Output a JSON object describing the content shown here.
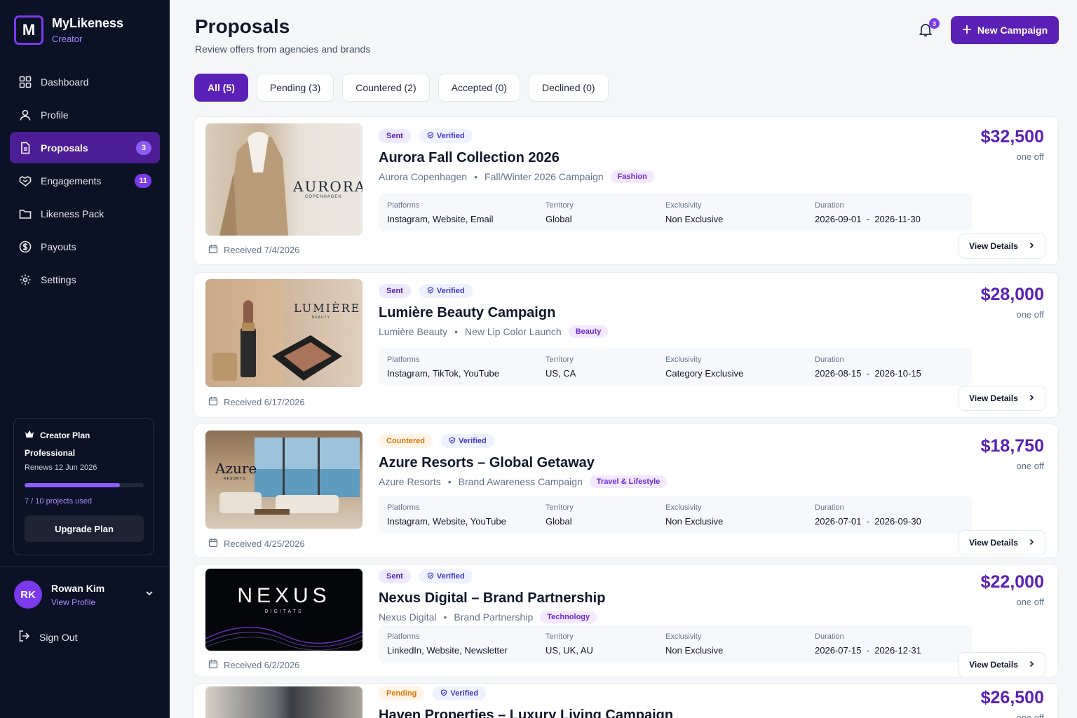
{
  "brand": {
    "initial": "M",
    "name": "MyLikeness",
    "role": "Creator"
  },
  "nav": [
    {
      "label": "Dashboard",
      "icon": "grid-icon"
    },
    {
      "label": "Profile",
      "icon": "user-icon"
    },
    {
      "label": "Proposals",
      "icon": "document-icon",
      "badge": "3",
      "active": true
    },
    {
      "label": "Engagements",
      "icon": "handshake-icon",
      "badge": "11"
    },
    {
      "label": "Likeness Pack",
      "icon": "folder-icon"
    },
    {
      "label": "Payouts",
      "icon": "dollar-icon"
    },
    {
      "label": "Settings",
      "icon": "gear-icon"
    }
  ],
  "plan": {
    "title": "Creator Plan",
    "tier": "Professional",
    "renews": "Renews 12 Jun 2026",
    "usage_label": "7 / 10 projects used",
    "usage_fraction": 0.8,
    "upgrade_label": "Upgrade Plan"
  },
  "user": {
    "initials": "RK",
    "name": "Rowan Kim",
    "link": "View Profile"
  },
  "signout_label": "Sign Out",
  "header": {
    "title": "Proposals",
    "subtitle": "Review offers from agencies and brands",
    "notifications": "3",
    "new_campaign": "New Campaign"
  },
  "tabs": [
    {
      "label": "All (5)",
      "active": true
    },
    {
      "label": "Pending (3)"
    },
    {
      "label": "Countered (2)"
    },
    {
      "label": "Accepted (0)"
    },
    {
      "label": "Declined (0)"
    }
  ],
  "labels": {
    "platforms": "Platforms",
    "territory": "Territory",
    "exclusivity": "Exclusivity",
    "duration": "Duration",
    "view_details": "View Details",
    "verified": "Verified",
    "duration_sep": "-"
  },
  "proposals": [
    {
      "status": "Sent",
      "status_type": "sent",
      "title": "Aurora Fall Collection 2026",
      "brand": "Aurora Copenhagen",
      "campaign": "Fall/Winter 2026 Campaign",
      "category": "Fashion",
      "platforms": "Instagram, Website, Email",
      "territory": "Global",
      "exclusivity": "Non Exclusive",
      "start": "2026-09-01",
      "end": "2026-11-30",
      "price": "$32,500",
      "frequency": "one off",
      "received": "Received 7/4/2026",
      "image_text": "AURORA",
      "image_sub": "COPENHAGEN"
    },
    {
      "status": "Sent",
      "status_type": "sent",
      "title": "Lumière Beauty Campaign",
      "brand": "Lumière Beauty",
      "campaign": "New Lip Color Launch",
      "category": "Beauty",
      "platforms": "Instagram, TikTok, YouTube",
      "territory": "US, CA",
      "exclusivity": "Category Exclusive",
      "start": "2026-08-15",
      "end": "2026-10-15",
      "price": "$28,000",
      "frequency": "one off",
      "received": "Received 6/17/2026",
      "image_text": "LUMIÈRE",
      "image_sub": "BEAUTY"
    },
    {
      "status": "Countered",
      "status_type": "countered",
      "title": "Azure Resorts – Global Getaway",
      "brand": "Azure Resorts",
      "campaign": "Brand Awareness Campaign",
      "category": "Travel & Lifestyle",
      "platforms": "Instagram, Website, YouTube",
      "territory": "Global",
      "exclusivity": "Non Exclusive",
      "start": "2026-07-01",
      "end": "2026-09-30",
      "price": "$18,750",
      "frequency": "one off",
      "received": "Received 4/25/2026",
      "image_text": "Azure",
      "image_sub": "RESORTS"
    },
    {
      "status": "Sent",
      "status_type": "sent",
      "title": "Nexus Digital – Brand Partnership",
      "brand": "Nexus Digital",
      "campaign": "Brand Partnership",
      "category": "Technology",
      "platforms": "LinkedIn, Website, Newsletter",
      "territory": "US, UK, AU",
      "exclusivity": "Non Exclusive",
      "start": "2026-07-15",
      "end": "2026-12-31",
      "price": "$22,000",
      "frequency": "one off",
      "received": "Received 6/2/2026",
      "image_text": "NEXUS",
      "image_sub": "DIGITATS"
    },
    {
      "status": "Pending",
      "status_type": "pending",
      "title": "Haven Properties – Luxury Living Campaign",
      "price": "$26,500",
      "frequency": "one off"
    }
  ]
}
